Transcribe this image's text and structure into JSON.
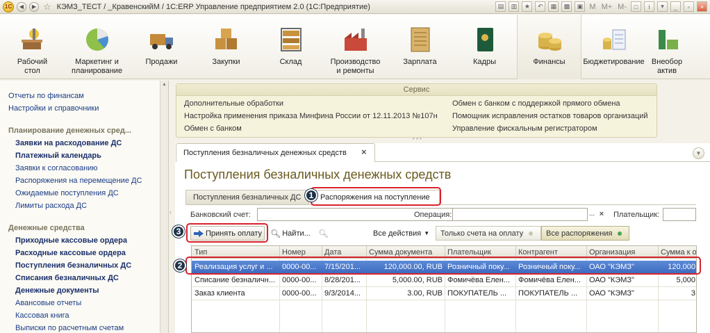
{
  "window": {
    "title": "КЭМЗ_ТЕСТ / _КравенскийМ / 1С:ERP Управление предприятием 2.0 (1С:Предприятие)",
    "logo": "1С",
    "right_labels": [
      "M",
      "M+",
      "M-"
    ]
  },
  "sections": [
    {
      "label": "Рабочий\nстол",
      "icon": "desktop-icon"
    },
    {
      "label": "Маркетинг и\nпланирование",
      "icon": "pie-chart-icon"
    },
    {
      "label": "Продажи",
      "icon": "truck-icon"
    },
    {
      "label": "Закупки",
      "icon": "boxes-icon"
    },
    {
      "label": "Склад",
      "icon": "warehouse-icon"
    },
    {
      "label": "Производство\nи ремонты",
      "icon": "factory-icon"
    },
    {
      "label": "Зарплата",
      "icon": "calendar-icon"
    },
    {
      "label": "Кадры",
      "icon": "passport-icon"
    },
    {
      "label": "Финансы",
      "icon": "coins-icon"
    },
    {
      "label": "Бюджетирование",
      "icon": "budget-icon"
    },
    {
      "label": "Внеобор\nактив",
      "icon": "assets-icon"
    }
  ],
  "active_section": "Финансы",
  "leftnav": {
    "top_links": [
      "Отчеты по финансам",
      "Настройки и справочники"
    ],
    "group1": "Планирование денежных сред...",
    "group1_items": [
      {
        "label": "Заявки на расходование ДС",
        "bold": true
      },
      {
        "label": "Платежный календарь",
        "bold": true
      },
      {
        "label": "Заявки к согласованию",
        "bold": false
      },
      {
        "label": "Распоряжения на перемещение ДС",
        "bold": false
      },
      {
        "label": "Ожидаемые поступления ДС",
        "bold": false
      },
      {
        "label": "Лимиты расхода ДС",
        "bold": false
      }
    ],
    "group2": "Денежные средства",
    "group2_items": [
      {
        "label": "Приходные кассовые ордера",
        "bold": true
      },
      {
        "label": "Расходные кассовые ордера",
        "bold": true
      },
      {
        "label": "Поступления безналичных ДС",
        "bold": true
      },
      {
        "label": "Списания безналичных ДС",
        "bold": true
      },
      {
        "label": "Денежные документы",
        "bold": true
      },
      {
        "label": "Авансовые отчеты",
        "bold": false
      },
      {
        "label": "Кассовая книга",
        "bold": false
      },
      {
        "label": "Выписки по расчетным счетам",
        "bold": false
      }
    ]
  },
  "service": {
    "title": "Сервис",
    "left": [
      "Дополнительные обработки",
      "Настройка применения приказа Минфина России от 12.11.2013 №107н",
      "Обмен с банком"
    ],
    "right": [
      "Обмен с банком с поддержкой прямого обмена",
      "Помощник исправления остатков товаров организаций",
      "Управление фискальным регистратором"
    ]
  },
  "document": {
    "tab_label": "Поступления безналичных денежных средств",
    "title": "Поступления безналичных денежных средств",
    "tabs": [
      "Поступления безналичных ДС",
      "Распоряжения на поступление"
    ]
  },
  "filters": {
    "bank_account_label": "Банковский счет:",
    "operation_label": "Операция:",
    "payer_label": "Плательщик:",
    "dots": "...",
    "clear": "×"
  },
  "toolbar": {
    "accept_payment": "Принять оплату",
    "find": "Найти...",
    "all_actions": "Все действия",
    "only_invoices": "Только счета на оплату",
    "all_orders": "Все распоряжения"
  },
  "markers": [
    "1",
    "2",
    "3"
  ],
  "table": {
    "columns": [
      "Тип",
      "Номер",
      "Дата",
      "Сумма документа",
      "Плательщик",
      "Контрагент",
      "Организация",
      "Сумма к о..."
    ],
    "rows": [
      [
        "Реализация услуг и ...",
        "0000-00...",
        "7/15/201...",
        "120,000.00, RUB",
        "Розничный поку...",
        "Розничный поку...",
        "ОАО \"КЭМЗ\"",
        "120,000"
      ],
      [
        "Списание безналичн...",
        "0000-00...",
        "8/28/201...",
        "5,000.00, RUB",
        "Фомичёва Елен...",
        "Фомичёва Елен...",
        "ОАО \"КЭМЗ\"",
        "5,000"
      ],
      [
        "Заказ клиента",
        "0000-00...",
        "9/3/2014...",
        "3.00, RUB",
        "ПОКУПАТЕЛЬ ...",
        "ПОКУПАТЕЛЬ ...",
        "ОАО \"КЭМЗ\"",
        "3"
      ]
    ]
  },
  "colors": {
    "highlight": "#d8222b",
    "selected_row": "#4a78c8",
    "accent_gold": "#6a5a1e",
    "link_blue": "#1b3c87"
  }
}
